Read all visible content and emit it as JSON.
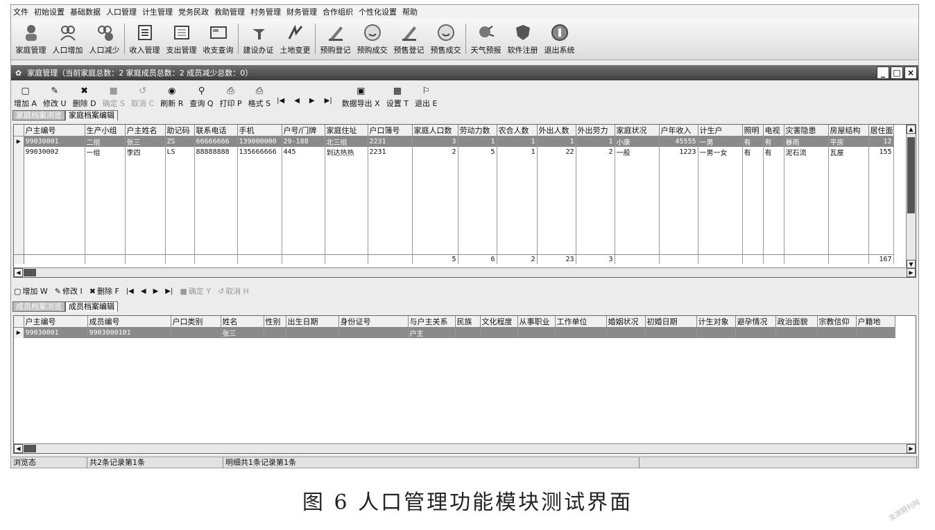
{
  "menu": [
    "文件",
    "初始设置",
    "基础数据",
    "人口管理",
    "计生管理",
    "党务民政",
    "救助管理",
    "村务管理",
    "财务管理",
    "合作组织",
    "个性化设置",
    "帮助"
  ],
  "toolbar": [
    {
      "label": "家庭管理",
      "icon": "family-icon"
    },
    {
      "label": "人口增加",
      "icon": "people-add-icon"
    },
    {
      "label": "人口减少",
      "icon": "people-remove-icon"
    },
    {
      "label": "收入管理",
      "icon": "income-icon"
    },
    {
      "label": "支出管理",
      "icon": "expense-icon"
    },
    {
      "label": "收支查询",
      "icon": "query-icon"
    },
    {
      "label": "建设办证",
      "icon": "build-icon"
    },
    {
      "label": "土地变更",
      "icon": "land-icon"
    },
    {
      "label": "预购登记",
      "icon": "pen-icon"
    },
    {
      "label": "预购成交",
      "icon": "smile-icon"
    },
    {
      "label": "预售登记",
      "icon": "pen-icon"
    },
    {
      "label": "预售成交",
      "icon": "smile-icon"
    },
    {
      "label": "天气预报",
      "icon": "weather-icon"
    },
    {
      "label": "软件注册",
      "icon": "shield-icon"
    },
    {
      "label": "退出系统",
      "icon": "exit-icon"
    }
  ],
  "window_title": "家庭管理（当前家庭总数：2  家庭成员总数：2  成员减少总数：0）",
  "win_buttons": [
    "_",
    "□",
    "×"
  ],
  "top_toolbar": [
    {
      "label": "增加 A",
      "icon": "▢",
      "disabled": false
    },
    {
      "label": "修改 U",
      "icon": "✎",
      "disabled": false
    },
    {
      "label": "删除 D",
      "icon": "✖",
      "disabled": false
    },
    {
      "label": "确定 S",
      "icon": "■",
      "disabled": true
    },
    {
      "label": "取消 C",
      "icon": "↺",
      "disabled": true
    },
    {
      "label": "刷新 R",
      "icon": "◉",
      "disabled": false
    },
    {
      "label": "查询 Q",
      "icon": "⚲",
      "disabled": false
    },
    {
      "label": "打印 P",
      "icon": "⎙",
      "disabled": false
    },
    {
      "label": "格式 S",
      "icon": "⎙",
      "disabled": false
    }
  ],
  "top_nav": [
    "|◀",
    "◀",
    "▶",
    "▶|"
  ],
  "top_toolbar2": [
    {
      "label": "数据导出 X",
      "icon": "▣"
    },
    {
      "label": "设置 T",
      "icon": "▦"
    },
    {
      "label": "退出 E",
      "icon": "⚐"
    }
  ],
  "top_tabs": [
    "家庭档案浏览",
    "家庭档案编辑"
  ],
  "family_columns": [
    "户主编号",
    "生产小组",
    "户主姓名",
    "助记码",
    "联系电话",
    "手机",
    "户号/门牌",
    "家庭住址",
    "户口簿号",
    "家庭人口数",
    "劳动力数",
    "农合人数",
    "外出人数",
    "外出劳力",
    "家庭状况",
    "户年收入",
    "计生户",
    "照明",
    "电视",
    "灾害隐患",
    "房屋结构",
    "居住面积"
  ],
  "family_rows": [
    [
      "99030001",
      "二组",
      "张三",
      "ZS",
      "66666666",
      "139000000",
      "29-188",
      "北三组",
      "2231",
      "3",
      "1",
      "1",
      "1",
      "1",
      "小康",
      "45555",
      "一男",
      "有",
      "有",
      "暴雨",
      "平房",
      "12"
    ],
    [
      "99030002",
      "一组",
      "李四",
      "LS",
      "88888888",
      "135666666",
      "445",
      "到达热热",
      "2231",
      "2",
      "5",
      "1",
      "22",
      "2",
      "一般",
      "1223",
      "一男一女",
      "有",
      "有",
      "泥石流",
      "瓦屋",
      "155"
    ]
  ],
  "family_totals": [
    "",
    "",
    "",
    "",
    "",
    "",
    "",
    "",
    "",
    "5",
    "6",
    "2",
    "23",
    "3",
    "",
    "",
    "",
    "",
    "",
    "",
    "",
    "167"
  ],
  "bottom_toolbar": [
    {
      "label": "增加 W",
      "icon": "▢",
      "disabled": false
    },
    {
      "label": "修改 I",
      "icon": "✎",
      "disabled": false
    },
    {
      "label": "删除 F",
      "icon": "✖",
      "disabled": false
    }
  ],
  "bottom_nav": [
    "|◀",
    "◀",
    "▶",
    "▶|"
  ],
  "bottom_toolbar2": [
    {
      "label": "确定 Y",
      "icon": "■",
      "disabled": true
    },
    {
      "label": "取消 H",
      "icon": "↺",
      "disabled": true
    }
  ],
  "bottom_tabs": [
    "成员档案浏览",
    "成员档案编辑"
  ],
  "member_columns": [
    "户主编号",
    "成员编号",
    "户口类别",
    "姓名",
    "性别",
    "出生日期",
    "身份证号",
    "与户主关系",
    "民族",
    "文化程度",
    "从事职业",
    "工作单位",
    "婚姻状况",
    "初婚日期",
    "计生对象",
    "避孕情况",
    "政治面貌",
    "宗教信仰",
    "户籍地"
  ],
  "member_rows": [
    [
      "99030001",
      "9903000101",
      "",
      "张三",
      "",
      "",
      "",
      "户主",
      "",
      "",
      "",
      "",
      "",
      "",
      "",
      "",
      "",
      "",
      ""
    ]
  ],
  "status": [
    "浏览态",
    "共2条记录第1条",
    "明细共1条记录第1条",
    ""
  ],
  "caption": "图 6   人口管理功能模块测试界面",
  "watermark": "龙源期刊网"
}
